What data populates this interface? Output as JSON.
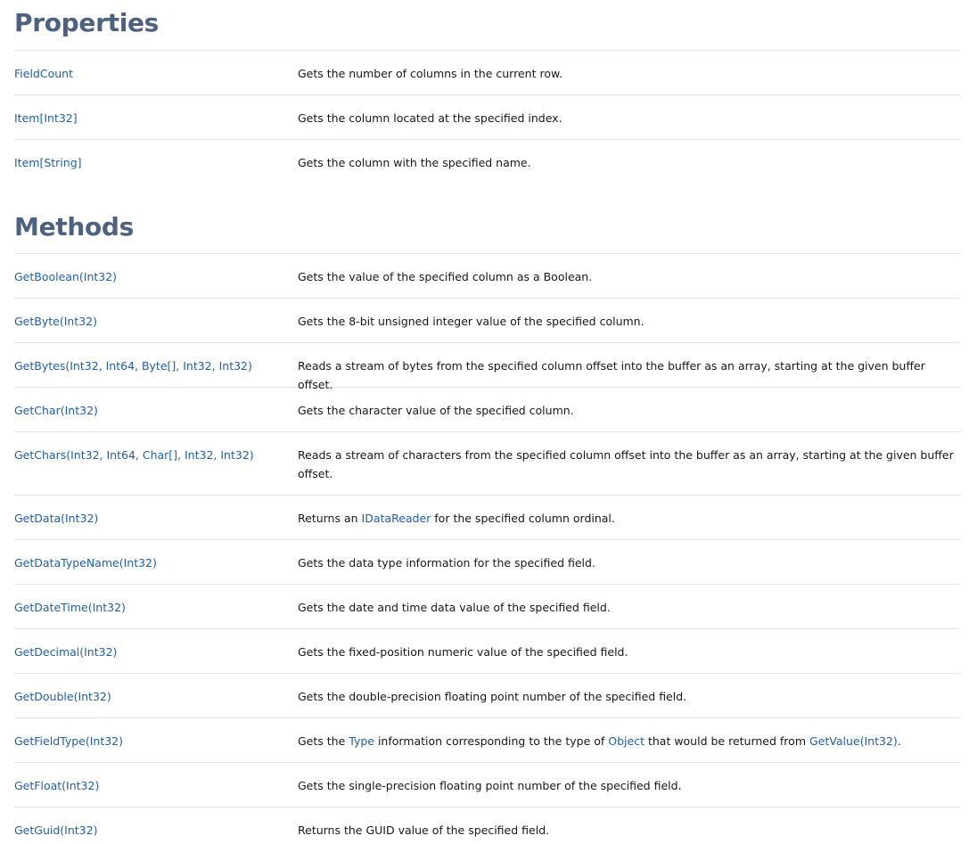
{
  "properties": {
    "title": "Properties",
    "rows": [
      {
        "name": "FieldCount",
        "desc": "Gets the number of columns in the current row."
      },
      {
        "name": "Item[Int32]",
        "desc": "Gets the column located at the specified index."
      },
      {
        "name": "Item[String]",
        "desc": "Gets the column with the specified name."
      }
    ]
  },
  "methods": {
    "title": "Methods",
    "rows": [
      {
        "name": "GetBoolean(Int32)",
        "desc": "Gets the value of the specified column as a Boolean."
      },
      {
        "name": "GetByte(Int32)",
        "desc": "Gets the 8-bit unsigned integer value of the specified column."
      },
      {
        "name": "GetBytes(Int32, Int64, Byte[], Int32, Int32)",
        "desc": "Reads a stream of bytes from the specified column offset into the buffer as an array, starting at the given buffer offset."
      },
      {
        "name": "GetChar(Int32)",
        "desc": "Gets the character value of the specified column."
      },
      {
        "name": "GetChars(Int32, Int64, Char[], Int32, Int32)",
        "desc": "Reads a stream of characters from the specified column offset into the buffer as an array, starting at the given buffer offset."
      },
      {
        "name": "GetData(Int32)",
        "desc_before": "Returns an ",
        "desc_link": "IDataReader",
        "desc_after": " for the specified column ordinal."
      },
      {
        "name": "GetDataTypeName(Int32)",
        "desc": "Gets the data type information for the specified field."
      },
      {
        "name": "GetDateTime(Int32)",
        "desc": "Gets the date and time data value of the specified field."
      },
      {
        "name": "GetDecimal(Int32)",
        "desc": "Gets the fixed-position numeric value of the specified field."
      },
      {
        "name": "GetDouble(Int32)",
        "desc": "Gets the double-precision floating point number of the specified field."
      },
      {
        "name": "GetFieldType(Int32)",
        "desc_part1": "Gets the ",
        "desc_link1": "Type",
        "desc_part2": " information corresponding to the type of ",
        "desc_link2": "Object",
        "desc_part3": " that would be returned from ",
        "desc_link3": "GetValue(Int32)",
        "desc_part4": "."
      },
      {
        "name": "GetFloat(Int32)",
        "desc": "Gets the single-precision floating point number of the specified field."
      },
      {
        "name": "GetGuid(Int32)",
        "desc": "Returns the GUID value of the specified field."
      }
    ]
  }
}
